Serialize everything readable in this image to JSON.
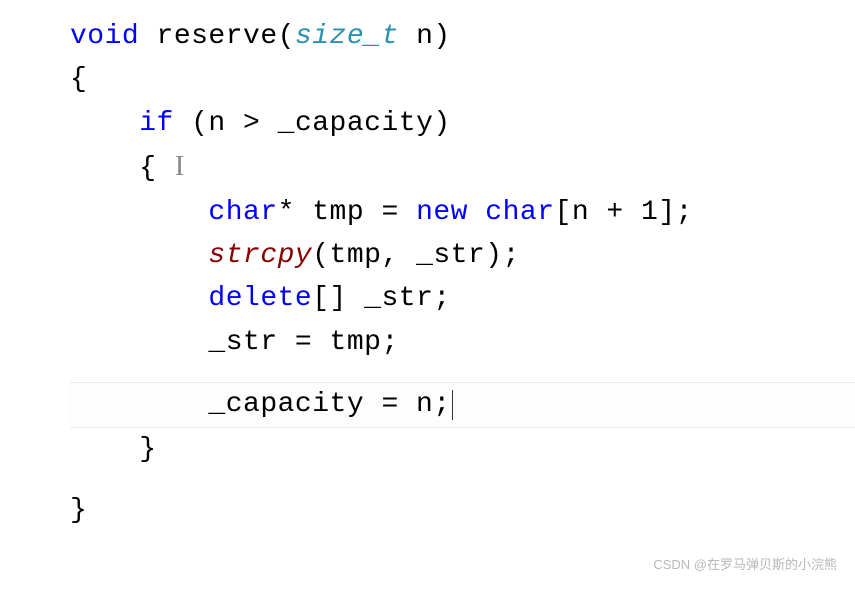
{
  "code": {
    "lines": [
      {
        "indent": 0,
        "tokens": [
          [
            "kw-blue",
            "void"
          ],
          [
            "txt",
            " reserve("
          ],
          [
            "kw-type",
            "size_t"
          ],
          [
            "txt",
            " n)"
          ]
        ]
      },
      {
        "indent": 0,
        "tokens": [
          [
            "txt",
            "{"
          ]
        ]
      },
      {
        "indent": 1,
        "tokens": [
          [
            "kw-blue",
            "if"
          ],
          [
            "txt",
            " (n > _capacity)"
          ]
        ]
      },
      {
        "indent": 1,
        "tokens": [
          [
            "txt",
            "{ "
          ]
        ],
        "ibeam": true
      },
      {
        "indent": 2,
        "tokens": [
          [
            "kw-blue",
            "char"
          ],
          [
            "txt",
            "* tmp = "
          ],
          [
            "kw-blue",
            "new"
          ],
          [
            "txt",
            " "
          ],
          [
            "kw-blue",
            "char"
          ],
          [
            "txt",
            "[n + 1];"
          ]
        ]
      },
      {
        "indent": 2,
        "tokens": [
          [
            "kw-func",
            "strcpy"
          ],
          [
            "txt",
            "(tmp, _str);"
          ]
        ]
      },
      {
        "indent": 2,
        "tokens": [
          [
            "kw-blue",
            "delete"
          ],
          [
            "txt",
            "[] _str;"
          ]
        ]
      },
      {
        "indent": 2,
        "tokens": [
          [
            "txt",
            "_str = tmp;"
          ]
        ]
      },
      {
        "indent": 2,
        "tokens": [],
        "blank": true
      },
      {
        "indent": 2,
        "tokens": [
          [
            "txt",
            "_capacity = n;"
          ]
        ],
        "highlight": true,
        "caret": true
      },
      {
        "indent": 1,
        "tokens": [
          [
            "txt",
            "}"
          ]
        ]
      },
      {
        "indent": 0,
        "tokens": [],
        "blank": true
      },
      {
        "indent": 0,
        "tokens": [
          [
            "txt",
            "}"
          ]
        ]
      }
    ],
    "indent_unit": "    "
  },
  "watermark": "CSDN @在罗马弹贝斯的小浣熊"
}
